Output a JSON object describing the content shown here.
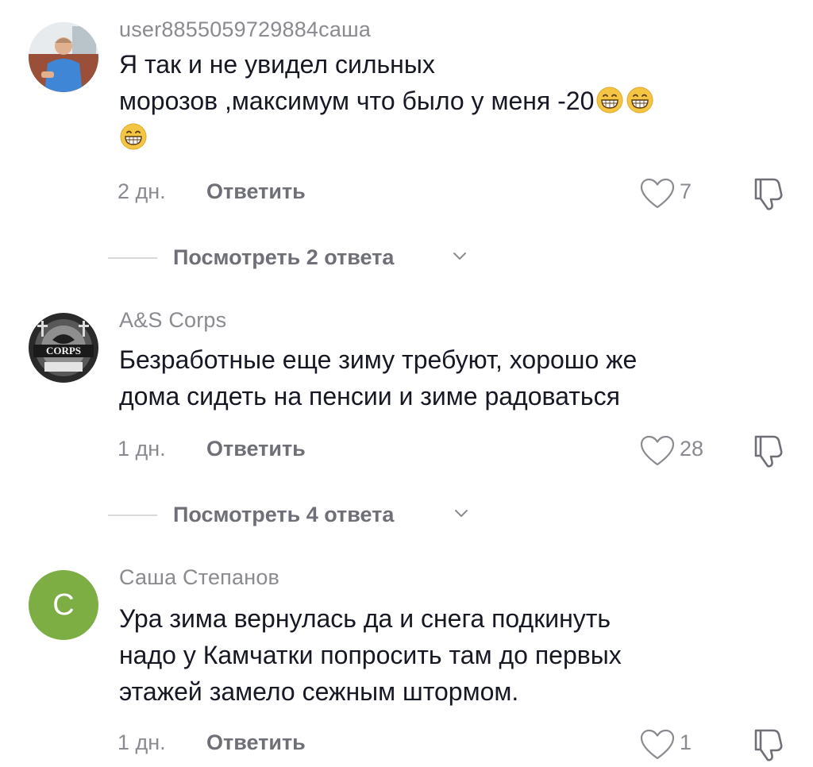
{
  "comments": [
    {
      "username": "user8855059729884саша",
      "text_lines": [
        "Я так и не увидел сильных",
        "морозов ,максимум что было у меня -20"
      ],
      "emoji": "grinning-face-emoji",
      "time": "2 дн.",
      "reply_label": "Ответить",
      "likes": "7",
      "view_replies": "Посмотреть 2 ответа"
    },
    {
      "username": "A&S Corps",
      "avatar_text": "CORPS",
      "text_lines": [
        "Безработные еще зиму требуют, хорошо же",
        "дома сидеть на пенсии и зиме радоваться"
      ],
      "time": "1 дн.",
      "reply_label": "Ответить",
      "likes": "28",
      "view_replies": "Посмотреть 4 ответа"
    },
    {
      "username": "Саша Степанов",
      "avatar_letter": "С",
      "avatar_color": "#7cae44",
      "text_lines": [
        "Ура зима вернулась да и снега подкинуть",
        "надо у Камчатки попросить там до первых",
        "этажей замело сежным штормом."
      ],
      "time": "1 дн.",
      "reply_label": "Ответить",
      "likes": "1"
    }
  ],
  "icons": {
    "like": "heart-outline-icon",
    "dislike": "thumbs-down-icon",
    "expand": "chevron-down-icon"
  },
  "colors": {
    "secondary_text": "#8a8b91",
    "primary_text": "#161823",
    "avatar_green": "#7cae44"
  }
}
